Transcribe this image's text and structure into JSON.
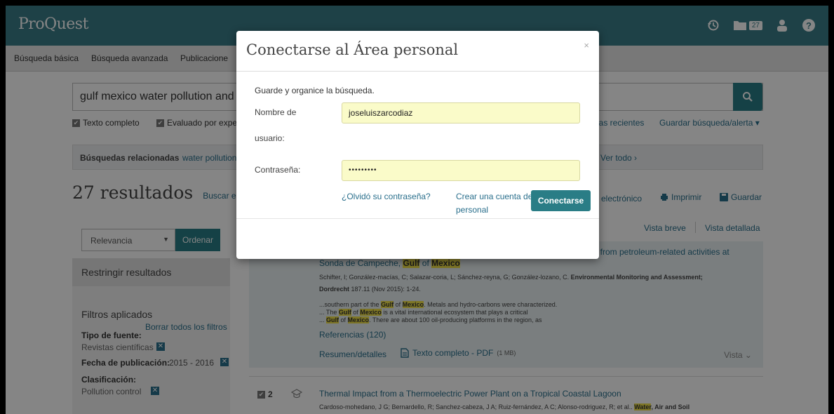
{
  "header": {
    "logo": "ProQuest",
    "folder_count": "27",
    "icons": [
      "history-icon",
      "folder-icon",
      "user-icon",
      "help-icon"
    ]
  },
  "nav": {
    "items": [
      "Búsqueda básica",
      "Búsqueda avanzada",
      "Publicacione"
    ]
  },
  "search": {
    "query": "gulf mexico water pollution and",
    "options": {
      "full_text": "Texto completo",
      "peer_reviewed": "Evaluado por expe"
    },
    "recent": "las recientes",
    "save": "Guardar búsqueda/alerta ▾"
  },
  "related": {
    "label": "Búsquedas relacionadas",
    "first": "water pollution",
    "see_all": "Ver todo ›"
  },
  "results": {
    "count_title": "27 resultados",
    "search_within": "Buscar en lo",
    "email": "electrónico",
    "print": "Imprimir",
    "save": "Guardar",
    "brief_view": "Vista breve",
    "detail_view": "Vista detallada"
  },
  "sort": {
    "selected": "Relevancia",
    "button": "Ordenar"
  },
  "sidebar": {
    "restrict": "Restringir resultados",
    "applied_title": "Filtros aplicados",
    "clear_all": "Borrar todos los filtros",
    "source_type_label": "Tipo de fuente:",
    "source_type_value": "Revistas científicas",
    "pubdate_label": "Fecha de publicación:",
    "pubdate_value": "2015 - 2016",
    "classification_label": "Clasificación:",
    "classification_value": "Pollution control"
  },
  "result1": {
    "title_tail": "t from petroleum-related activities at",
    "title_line2_a": "Sonda de Campeche,",
    "title_gulf": "Gulf",
    "title_of": "of",
    "title_mexico": "Mexico",
    "authors": "Schifter, I; González-macías, C; Salazar-coria, L; Sánchez-reyna, G; González-lozano, C.",
    "journal": "Environmental Monitoring and Assessment;",
    "journal2": "Dordrecht",
    "citation": "187.11 (Nov 2015): 1-24.",
    "snippet1_a": "...southern part of the",
    "snippet1_b": "Metals and hydro-carbons were characterized.",
    "snippet2_a": "... The",
    "snippet2_b": "is a vital international ecosystem that plays a critical",
    "snippet3_a": "...",
    "snippet3_b": ". There are about 100 oil-producing platforms in the region, as",
    "references": "Referencias (120)",
    "abstract_link": "Resumen/detalles",
    "fulltext_link": "Texto completo - PDF",
    "fulltext_size": "(1 MB)",
    "view": "Vista ⌄"
  },
  "result2": {
    "number": "2",
    "title": "Thermal Impact from a Thermoelectric Power Plant on a Tropical Coastal Lagoon",
    "authors": "Cardoso-mohedano, J G; Bernardello, R; Sanchez-cabeza, J A; Ruiz-fernández, A C; Alonso-rodriguez, R; et al..",
    "water": "Water",
    "tail": ", Air and Soil"
  },
  "modal": {
    "title": "Conectarse al Área personal",
    "close": "×",
    "subtitle": "Guarde y organice la búsqueda.",
    "username_label_1": "Nombre de",
    "username_label_2": "usuario:",
    "username_value": "joseluiszarcodiaz",
    "password_label": "Contraseña:",
    "password_value": "•••••••••",
    "forgot_link": "¿Olvidó su contraseña?",
    "create_link_1": "Crear una cuenta del Área",
    "create_link_2": "personal",
    "connect_button": "Conectarse"
  },
  "colors": {
    "brand": "#3a7e88",
    "button": "#2a7d86",
    "highlight": "#f2e34a",
    "input_fill": "#fafbc9"
  }
}
